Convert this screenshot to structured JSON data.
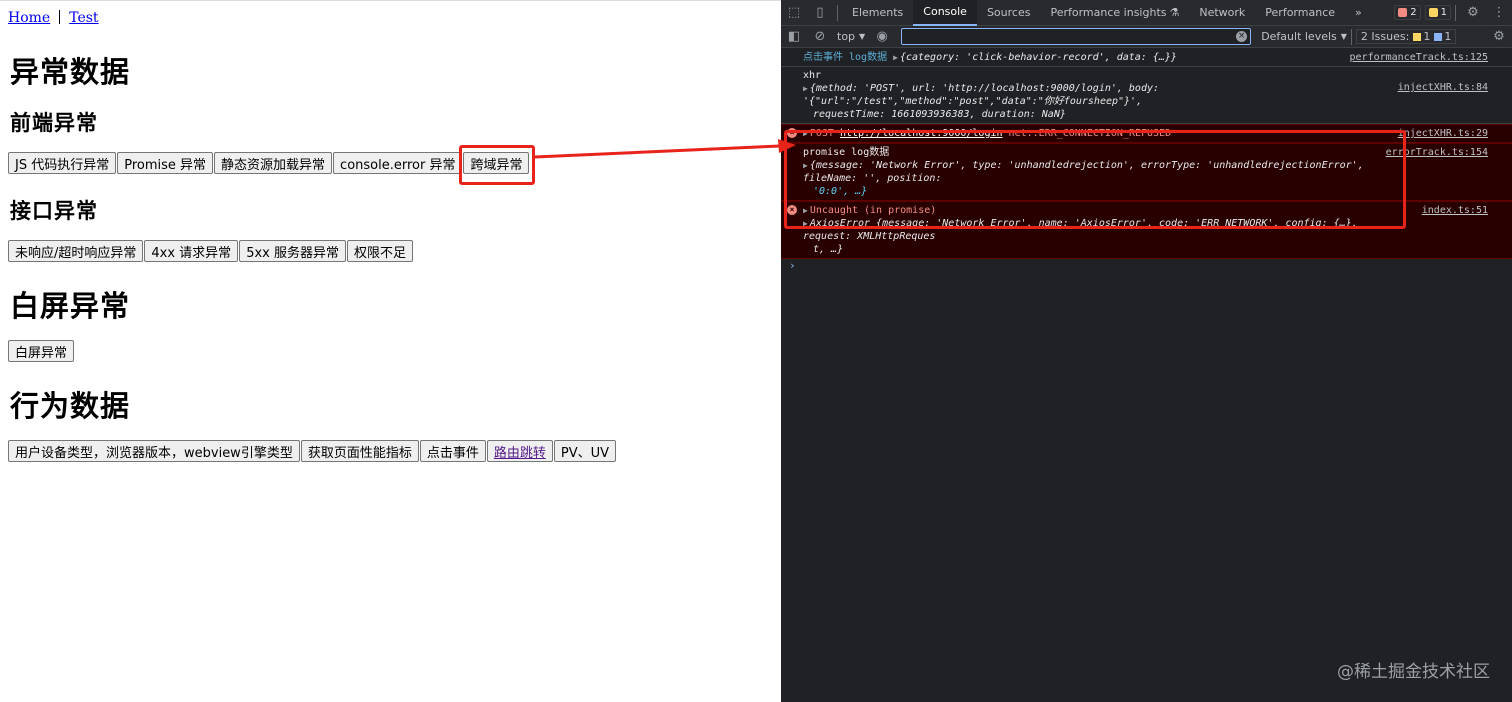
{
  "nav": {
    "home": "Home",
    "test": "Test"
  },
  "headings": {
    "exception_data": "异常数据",
    "frontend_exception": "前端异常",
    "api_exception": "接口异常",
    "white_screen": "白屏异常",
    "behavior_data": "行为数据"
  },
  "frontend_buttons": [
    "JS 代码执行异常",
    "Promise 异常",
    "静态资源加载异常",
    "console.error 异常",
    "跨域异常"
  ],
  "api_buttons": [
    "未响应/超时响应异常",
    "4xx 请求异常",
    "5xx 服务器异常",
    "权限不足"
  ],
  "white_buttons": [
    "白屏异常"
  ],
  "behavior_buttons": [
    "用户设备类型，浏览器版本，webview引擎类型",
    "获取页面性能指标",
    "点击事件",
    "路由跳转",
    "PV、UV"
  ],
  "devtools": {
    "tabs": [
      "Elements",
      "Console",
      "Sources",
      "Performance insights",
      "Network",
      "Performance"
    ],
    "active_tab": "Console",
    "more": "»",
    "error_count": "2",
    "warn_count": "1",
    "context": "top",
    "levels": "Default levels",
    "issues_label": "2 Issues:",
    "issues_warn": "1",
    "issues_info": "1",
    "watermark": "@稀土掘金技术社区"
  },
  "console": {
    "line1": {
      "prefix": "点击事件 log数据",
      "text": "{category: 'click-behavior-record', data: {…}}",
      "src": "performanceTrack.ts:125"
    },
    "line2": {
      "title": "xhr",
      "src": "injectXHR.ts:84",
      "obj1": "{method: 'POST', url: 'http://localhost:9000/login', body: '{\"url\":\"/test\",\"method\":\"post\",\"data\":\"你好foursheep\"}',",
      "obj2": "requestTime: 1661093936383, duration: NaN}"
    },
    "line3": {
      "method": "POST",
      "url": "http://localhost:9000/login",
      "error": "net::ERR_CONNECTION_REFUSED",
      "src": "injectXHR.ts:29"
    },
    "line4": {
      "title": "promise log数据",
      "src": "errorTrack.ts:154",
      "obj1": "{message: 'Network Error', type: 'unhandledrejection', errorType: 'unhandledrejectionError', fileName: '', position:",
      "obj2": "'0:0', …}"
    },
    "line5": {
      "title": "Uncaught (in promise)",
      "src": "index.ts:51",
      "obj1": "AxiosError {message: 'Network Error', name: 'AxiosError', code: 'ERR_NETWORK', config: {…}, request: XMLHttpReques",
      "obj2": "t, …}"
    }
  }
}
